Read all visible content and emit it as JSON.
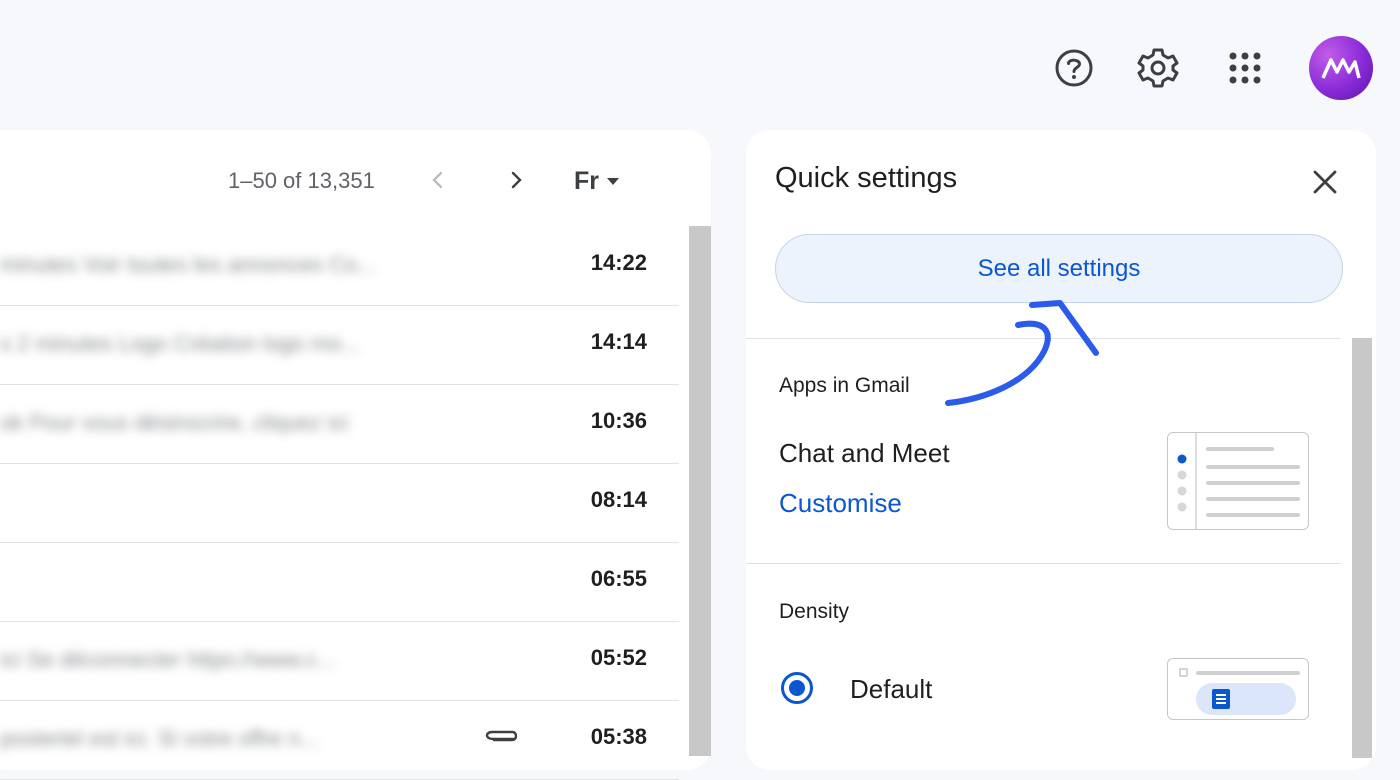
{
  "header": {
    "icons": [
      "help-icon",
      "settings-gear-icon",
      "google-apps-grid-icon"
    ],
    "avatar_color": "#8a2bd8"
  },
  "mail_list": {
    "pagination": "1–50 of 13,351",
    "language_label": "Fr",
    "rows": [
      {
        "snippet": "minutes Voir toutes les annonces Co...",
        "time": "14:22",
        "attachment": false
      },
      {
        "snippet": "s 2 minutes Logo Création logo mo...",
        "time": "14:14",
        "attachment": false
      },
      {
        "snippet": "ok Pour vous désinscrire, cliquez ici",
        "time": "10:36",
        "attachment": false
      },
      {
        "snippet": "",
        "time": "08:14",
        "attachment": false
      },
      {
        "snippet": "",
        "time": "06:55",
        "attachment": false
      },
      {
        "snippet": "ici Se déconnecter https://www.c...",
        "time": "05:52",
        "attachment": false
      },
      {
        "snippet": "posteriel est ici. Si votre offre n...",
        "time": "05:38",
        "attachment": true
      }
    ]
  },
  "quick_settings": {
    "title": "Quick settings",
    "see_all_label": "See all settings",
    "apps_section": "Apps in Gmail",
    "chat_meet_label": "Chat and Meet",
    "customise_label": "Customise",
    "density_section": "Density",
    "density_default_label": "Default",
    "accent_color": "#0b57d0",
    "annotation_color": "#2a5bea"
  }
}
